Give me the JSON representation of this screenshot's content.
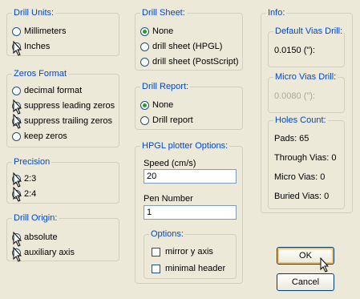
{
  "drill_units": {
    "title": "Drill Units:",
    "options": [
      "Millimeters",
      "Inches"
    ],
    "selected": 1
  },
  "zeros_format": {
    "title": "Zeros Format",
    "options": [
      "decimal format",
      "suppress leading zeros",
      "suppress trailing zeros",
      "keep zeros"
    ],
    "selected": 1
  },
  "precision": {
    "title": "Precision",
    "options": [
      "2:3",
      "2:4"
    ],
    "selected": 0
  },
  "drill_origin": {
    "title": "Drill Origin:",
    "options": [
      "absolute",
      "auxiliary axis"
    ],
    "selected": 0
  },
  "drill_sheet": {
    "title": "Drill Sheet:",
    "options": [
      "None",
      "drill sheet (HPGL)",
      "drill sheet (PostScript)"
    ],
    "selected": 0
  },
  "drill_report": {
    "title": "Drill Report:",
    "options": [
      "None",
      "Drill report"
    ],
    "selected": 0
  },
  "hpgl": {
    "title": "HPGL plotter Options:",
    "speed_label": "Speed (cm/s)",
    "speed_value": "20",
    "pen_label": "Pen Number",
    "pen_value": "1",
    "options_title": "Options:",
    "mirror_label": "mirror y axis",
    "minimal_label": "minimal header"
  },
  "info": {
    "title": "Info:",
    "default_vias": {
      "title": "Default Vias Drill:",
      "value": "0.0150 (\"):"
    },
    "micro_vias": {
      "title": "Micro Vias Drill:",
      "value": "0.0080 (\"):"
    },
    "holes": {
      "title": "Holes Count:",
      "pads": "Pads: 65",
      "through": "Through Vias: 0",
      "micro": "Micro Vias: 0",
      "buried": "Buried Vias: 0"
    }
  },
  "buttons": {
    "ok": "OK",
    "cancel": "Cancel"
  }
}
